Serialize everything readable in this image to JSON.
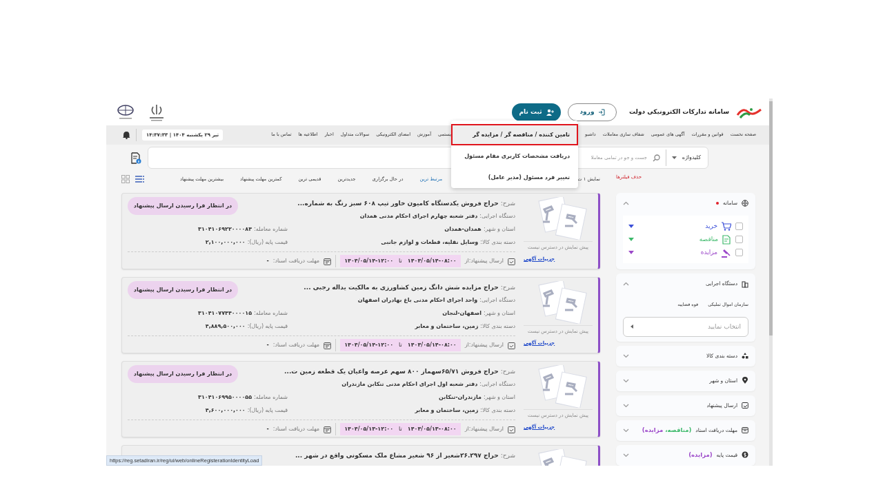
{
  "header": {
    "title": "سامانه تدارکات الکترونیکی دولت",
    "login_button": "ورود",
    "register_button": "ثبت نام"
  },
  "register_menu": [
    {
      "label": "تامین کننده / مناقصه گر / مزایده گر",
      "selected": true
    },
    {
      "label": "دریافت مشخصات کاربری مقام مسئول",
      "selected": false
    },
    {
      "label": "تغییر فرد مسئول (مدیر عامل)",
      "selected": false
    }
  ],
  "nav": {
    "items_before_menu": [
      "صفحه نخست",
      "قوانین و مقررات",
      "آگهی های عمومی",
      "شفاف سازی معاملات",
      "داشبو"
    ],
    "items_after_menu": [
      "یستمی",
      "آموزش",
      "امضای الکترونیکی",
      "سوالات متداول",
      "اخبار",
      "اطلاعیه ها",
      "تماس با ما"
    ],
    "datetime": "تیر ۲۹ یکشنبه ۱۴۰۴ | ۱۴:۳۷:۳۳"
  },
  "search": {
    "scope": "کلیدواژه",
    "placeholder": "جست و جو در تمامی معاملا"
  },
  "clear_filters": "حذف فیلترها",
  "results_text": "نمایش ۱ ت",
  "sort_options": [
    {
      "label": "مرتبط ترین",
      "selected": true
    },
    {
      "label": "در حال برگزاری",
      "selected": false
    },
    {
      "label": "جدیدترین",
      "selected": false
    },
    {
      "label": "قدیمی ترین",
      "selected": false
    },
    {
      "label": "کمترین مهلت پیشنهاد",
      "selected": false
    },
    {
      "label": "بیشترین مهلت پیشنهاد",
      "selected": false
    }
  ],
  "view_modes": [
    {
      "kind": "grid",
      "selected": false
    },
    {
      "kind": "list",
      "selected": true
    }
  ],
  "cards": [
    {
      "title_label": "شرح:",
      "title": "حراج فروش یکدستگاه کامیون خاور تیپ ۶۰۸ سبز رنگ به شماره...",
      "status": "در انتظار فرا رسیدن ارسال پیشنهاد",
      "agency": {
        "label": "دستگاه اجرایی:",
        "value": "دفتر شعبه چهارم اجرای احکام مدنی همدان"
      },
      "location": {
        "label": "استان و شهر:",
        "value": "همدان-همدان"
      },
      "deal_number": {
        "label": "شماره معامله:",
        "value": "۳۱۰۴۱۰۶۹۲۲۰۰۰۰۸۴"
      },
      "category": {
        "label": "دسته بندی کالا:",
        "value": "وسایل نقلیه، قطعات و لوازم جانبی"
      },
      "base_price": {
        "label": "قیمت پایه (ریال):",
        "value": "۲,۱۰۰,۰۰۰,۰۰۰"
      },
      "send": {
        "label": "ارسال پیشنهاد:از",
        "from": "۱۴۰۴/۰۵/۱۴-۰۸:۰۰",
        "to_label": "تا",
        "to": "۱۴۰۴/۰۵/۱۴-۱۲:۰۰"
      },
      "docs": {
        "label": "مهلت دریافت اسناد:",
        "value": "-"
      },
      "preview": "پیش نمایش در دسترس نیست",
      "details": "جزییات آگهی"
    },
    {
      "title_label": "شرح:",
      "title": "حراج مزایده شش دانگ زمین کشاورزی به مالکیت یداله رجبی ...",
      "status": "در انتظار فرا رسیدن ارسال پیشنهاد",
      "agency": {
        "label": "دستگاه اجرایی:",
        "value": "واحد اجرای احکام مدنی باغ بهادران اصفهان"
      },
      "location": {
        "label": "استان و شهر:",
        "value": "اصفهان-لنجان"
      },
      "deal_number": {
        "label": "شماره معامله:",
        "value": "۳۱۰۴۱۰۷۷۴۴۰۰۰۰۱۵"
      },
      "category": {
        "label": "دسته بندی کالا:",
        "value": "زمین، ساختمان و معابر"
      },
      "base_price": {
        "label": "قیمت پایه (ریال):",
        "value": "۴,۸۸۹,۵۰۰,۰۰۰"
      },
      "send": {
        "label": "ارسال پیشنهاد:از",
        "from": "۱۴۰۴/۰۵/۱۴-۰۸:۰۰",
        "to_label": "تا",
        "to": "۱۴۰۴/۰۵/۱۴-۱۲:۰۰"
      },
      "docs": {
        "label": "مهلت دریافت اسناد:",
        "value": "-"
      },
      "preview": "پیش نمایش در دسترس نیست",
      "details": "جزییات آگهی"
    },
    {
      "title_label": "شرح:",
      "title": "حراج فروش ۶۵/۷۱سهماز ۸۰۰ سهم عرصه واعیان یک قطعه زمین ت...",
      "status": "در انتظار فرا رسیدن ارسال پیشنهاد",
      "agency": {
        "label": "دستگاه اجرایی:",
        "value": "دفتر شعبه اول اجرای احکام مدنی تنکابن مازندران"
      },
      "location": {
        "label": "استان و شهر:",
        "value": "مازندران-تنکابن"
      },
      "deal_number": {
        "label": "شماره معامله:",
        "value": "۳۱۰۴۱۰۶۹۹۵۰۰۰۰۵۵"
      },
      "category": {
        "label": "دسته بندی کالا:",
        "value": "زمین، ساختمان و معابر"
      },
      "base_price": {
        "label": "قیمت پایه (ریال):",
        "value": "۴,۶۰۰,۰۰۰,۰۰۰"
      },
      "send": {
        "label": "ارسال پیشنهاد:از",
        "from": "۱۴۰۴/۰۵/۱۳-۰۸:۰۰",
        "to_label": "تا",
        "to": "۱۴۰۴/۰۵/۱۳-۱۲:۰۰"
      },
      "docs": {
        "label": "مهلت دریافت اسناد:",
        "value": "-"
      },
      "preview": "پیش نمایش در دسترس نیست",
      "details": "جزییات آگهی"
    },
    {
      "title_label": "شرح:",
      "title": "حراج ۲۶.۲۹۷شعیر از ۹۶ شعیر مشاع ملک مسکونی واقع در شهر ..."
    }
  ],
  "filters": [
    {
      "kind": "systems",
      "label": "سامانه",
      "required": true,
      "expanded": true,
      "options": [
        {
          "label": "خرید",
          "color": "#3b4fd8",
          "checked": false
        },
        {
          "label": "مناقصه",
          "color": "#3cb96a",
          "checked": false
        },
        {
          "label": "مزایده",
          "color": "#9b47c9",
          "checked": false
        }
      ]
    },
    {
      "kind": "agency",
      "label": "دستگاه اجرایی",
      "required": false,
      "expanded": true,
      "links": [
        "سازمان اموال تملیکی",
        "قوه قضاییه"
      ],
      "placeholder": "انتخاب نمایید"
    },
    {
      "kind": "plain",
      "label": "دسته بندی کالا",
      "required": false,
      "expanded": false
    },
    {
      "kind": "plain",
      "label": "استان و شهر",
      "required": false,
      "expanded": false
    },
    {
      "kind": "plain",
      "label": "ارسال پیشنهاد",
      "required": false,
      "expanded": false
    },
    {
      "kind": "plain",
      "label": "مهلت دریافت اسناد",
      "required": false,
      "expanded": false,
      "note": [
        {
          "text": "(مناقصه،",
          "color": "#3cb96a"
        },
        {
          "text": " مزایده)",
          "color": "#9b47c9"
        }
      ]
    },
    {
      "kind": "plain",
      "label": "قیمت پایه",
      "required": false,
      "expanded": false,
      "note": [
        {
          "text": "(مزایده)",
          "color": "#9b47c9"
        }
      ]
    }
  ],
  "status_bar": "https://reg.setadiran.ir/reg/ui/web/onlineRegisterationIdentityLoad"
}
